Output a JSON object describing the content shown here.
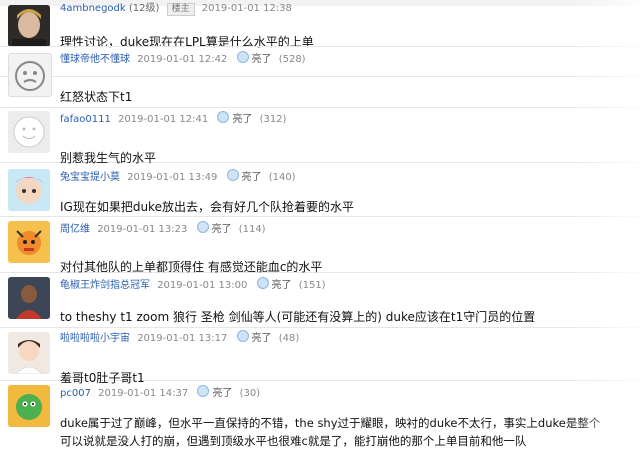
{
  "comments": [
    {
      "user": "4ambnegodk",
      "level": "(12级)",
      "badge": "楼主",
      "time": "2019-01-01 12:38",
      "text": "理性讨论，duke现在在LPL算是什么水平的上单"
    },
    {
      "user": "懂球帝他不懂球",
      "time": "2019-01-01 12:42",
      "like_label": "亮了",
      "count": "(528)",
      "text": "红怒状态下t1"
    },
    {
      "user": "fafao0111",
      "time": "2019-01-01 12:41",
      "like_label": "亮了",
      "count": "(312)",
      "text": "别惹我生气的水平"
    },
    {
      "user": "兔宝宝提小莫",
      "time": "2019-01-01 13:49",
      "like_label": "亮了",
      "count": "(140)",
      "text": "IG现在如果把duke放出去，会有好几个队抢着要的水平"
    },
    {
      "user": "周亿维",
      "time": "2019-01-01 13:23",
      "like_label": "亮了",
      "count": "(114)",
      "text": "对付其他队的上单都顶得住 有感觉还能血c的水平"
    },
    {
      "user": "龟椒王炸剑指总冠军",
      "time": "2019-01-01 13:00",
      "like_label": "亮了",
      "count": "(151)",
      "text": "to theshy t1 zoom 狼行 圣枪 剑仙等人(可能还有没算上的) duke应该在t1守门员的位置"
    },
    {
      "user": "啦啦啦啦小宇宙",
      "time": "2019-01-01 13:17",
      "like_label": "亮了",
      "count": "(48)",
      "text": "羞哥t0肚子哥t1"
    },
    {
      "user": "pc007",
      "time": "2019-01-01 14:37",
      "like_label": "亮了",
      "count": "(30)",
      "text": "duke属于过了巅峰，但水平一直保持的不错，the shy过于耀眼，映衬的duke不太行，事实上duke是整个",
      "text2": "可以说就是没人打的崩，但遇到顶级水平也很难c就是了，能打崩他的那个上单目前和他一队"
    }
  ]
}
